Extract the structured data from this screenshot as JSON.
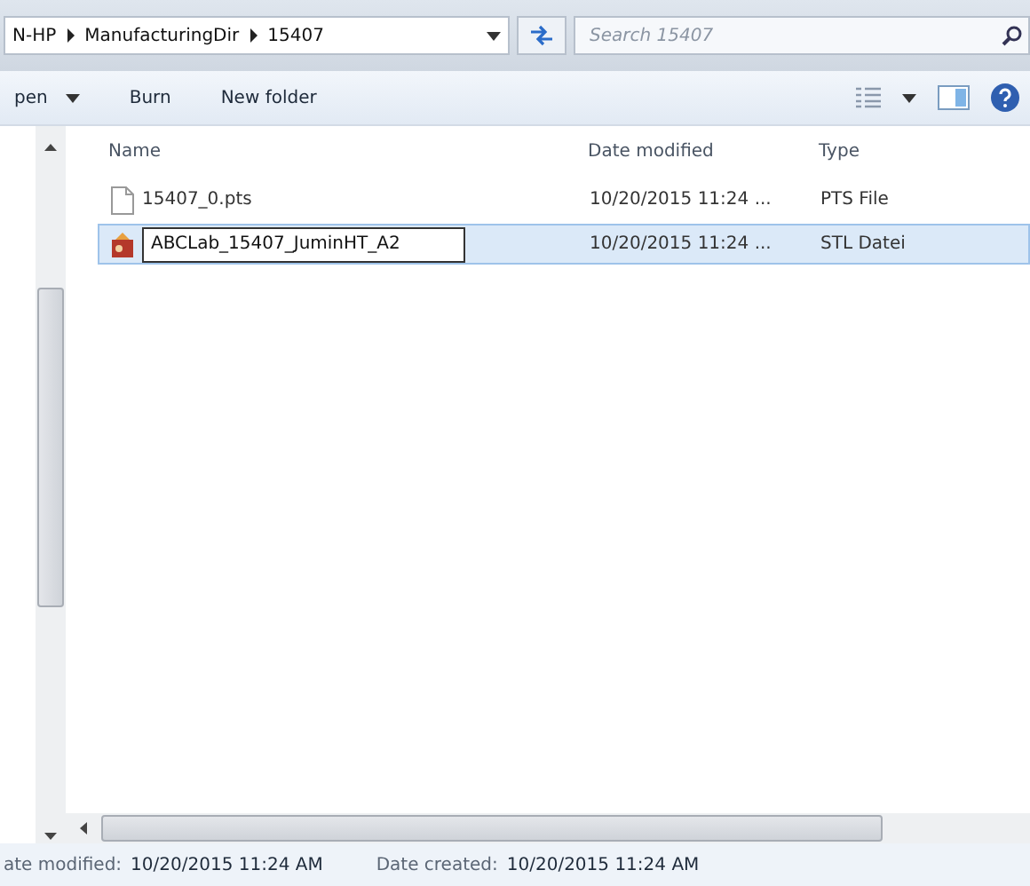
{
  "address_bar": {
    "crumbs": [
      "N-HP",
      "ManufacturingDir",
      "15407"
    ]
  },
  "search": {
    "placeholder": "Search 15407"
  },
  "toolbar": {
    "buttons": [
      {
        "label": "pen",
        "dropdown": true
      },
      {
        "label": "Burn",
        "dropdown": false
      },
      {
        "label": "New folder",
        "dropdown": false
      }
    ]
  },
  "columns": [
    "Name",
    "Date modified",
    "Type"
  ],
  "files": [
    {
      "name": "15407_0.pts",
      "date": "10/20/2015 11:24 ...",
      "type": "PTS File",
      "selected": false,
      "renaming": false,
      "kind": "document"
    },
    {
      "name": "ABCLab_15407_JuminHT_A2",
      "date": "10/20/2015 11:24 ...",
      "type": "STL Datei",
      "selected": true,
      "renaming": true,
      "kind": "model"
    }
  ],
  "status_bar": [
    {
      "label": "ate modified:",
      "value": "10/20/2015 11:24 AM"
    },
    {
      "label": "Date created:",
      "value": "10/20/2015 11:24 AM"
    }
  ]
}
